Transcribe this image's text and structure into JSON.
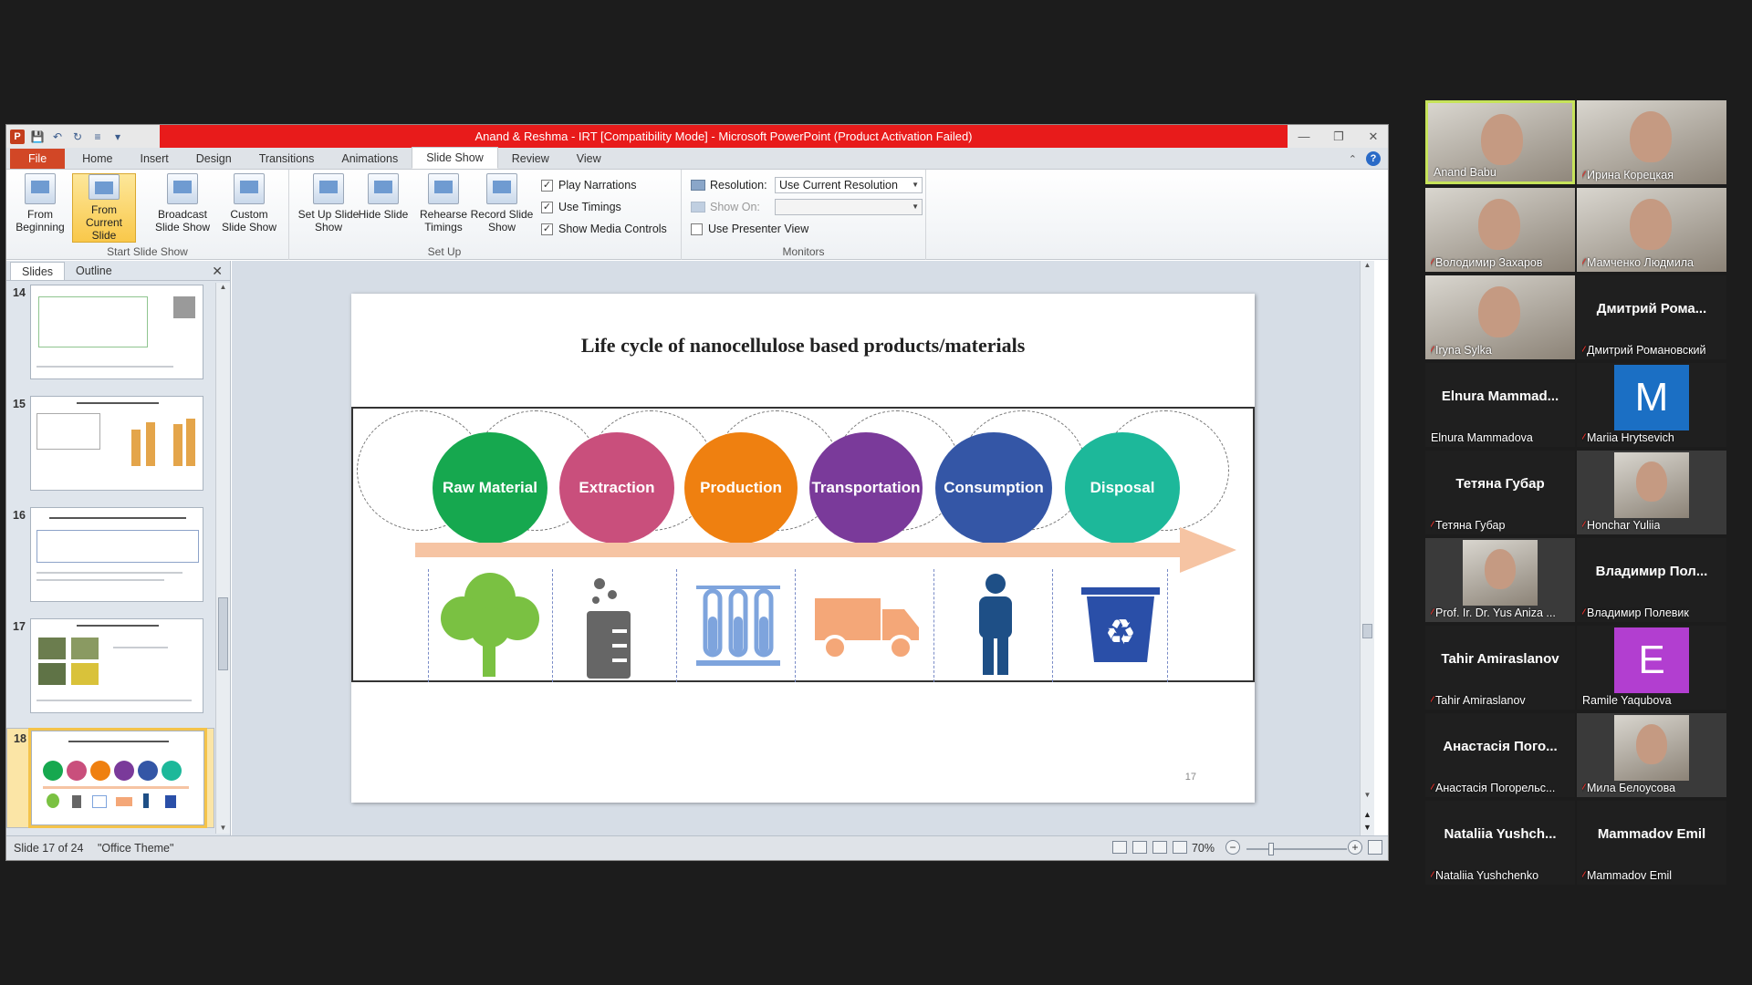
{
  "window": {
    "title": "Anand & Reshma - IRT [Compatibility Mode] - Microsoft PowerPoint (Product Activation Failed)",
    "app_icon": "P"
  },
  "tabs": [
    "File",
    "Home",
    "Insert",
    "Design",
    "Transitions",
    "Animations",
    "Slide Show",
    "Review",
    "View"
  ],
  "active_tab": "Slide Show",
  "ribbon": {
    "start_group": "Start Slide Show",
    "from_beginning": "From Beginning",
    "from_current": "From Current Slide",
    "broadcast": "Broadcast Slide Show",
    "custom": "Custom Slide Show",
    "setup_group": "Set Up",
    "setup_show": "Set Up Slide Show",
    "hide_slide": "Hide Slide",
    "rehearse": "Rehearse Timings",
    "record": "Record Slide Show",
    "play_narrations": "Play Narrations",
    "use_timings": "Use Timings",
    "show_media_controls": "Show Media Controls",
    "monitors_group": "Monitors",
    "resolution_label": "Resolution:",
    "resolution_value": "Use Current Resolution",
    "show_on_label": "Show On:",
    "presenter_view": "Use Presenter View"
  },
  "pane": {
    "tab_slides": "Slides",
    "tab_outline": "Outline",
    "thumbnails": [
      {
        "num": "14"
      },
      {
        "num": "15"
      },
      {
        "num": "16"
      },
      {
        "num": "17"
      },
      {
        "num": "18"
      }
    ]
  },
  "slide": {
    "title": "Life cycle of nanocellulose based products/materials",
    "stages": [
      {
        "label": "Raw Material",
        "color": "#16a84f"
      },
      {
        "label": "Extraction",
        "color": "#c94f7c"
      },
      {
        "label": "Production",
        "color": "#ef8010"
      },
      {
        "label": "Transportation",
        "color": "#7a3a9a"
      },
      {
        "label": "Consumption",
        "color": "#3456a6"
      },
      {
        "label": "Disposal",
        "color": "#1db89a"
      }
    ],
    "number": "17"
  },
  "status": {
    "slide_info": "Slide 17 of 24",
    "theme": "\"Office Theme\"",
    "zoom": "70%"
  },
  "participants": [
    {
      "name": "Anand Babu",
      "muted": false,
      "video": true,
      "active": true
    },
    {
      "name": "Ирина Корецкая",
      "muted": true,
      "video": true
    },
    {
      "name": "Володимир Захаров",
      "muted": true,
      "video": true
    },
    {
      "name": "Мамченко Людмила",
      "muted": true,
      "video": true
    },
    {
      "name": "Iryna Sylka",
      "muted": true,
      "video": true
    },
    {
      "big": "Дмитрий Рома...",
      "name": "Дмитрий Романовский",
      "muted": true
    },
    {
      "big": "Elnura Mammad...",
      "name": "Elnura Mammadova",
      "muted": false
    },
    {
      "letter": "M",
      "letter_color": "#1b6fc4",
      "name": "Mariia Hrytsevich",
      "muted": true
    },
    {
      "big": "Тетяна Губар",
      "name": "Тетяна Губар",
      "muted": true
    },
    {
      "name": "Honchar Yuliia",
      "muted": true,
      "photo": true
    },
    {
      "name": "Prof. Ir. Dr. Yus Aniza ...",
      "muted": true,
      "photo": true
    },
    {
      "big": "Владимир Пол...",
      "name": "Владимир Полевик",
      "muted": true
    },
    {
      "big": "Tahir Amiraslanov",
      "name": "Tahir Amiraslanov",
      "muted": true
    },
    {
      "letter": "E",
      "letter_color": "#b23ed0",
      "name": "Ramile Yaqubova",
      "muted": false
    },
    {
      "big": "Анастасія Пого...",
      "name": "Анастасія Погорельс...",
      "muted": true
    },
    {
      "name": "Мила Белоусова",
      "muted": true,
      "photo": true
    },
    {
      "big": "Nataliia Yushch...",
      "name": "Nataliia Yushchenko",
      "muted": true
    },
    {
      "big": "Mammadov Emil",
      "name": "Mammadov Emil",
      "muted": true
    }
  ]
}
